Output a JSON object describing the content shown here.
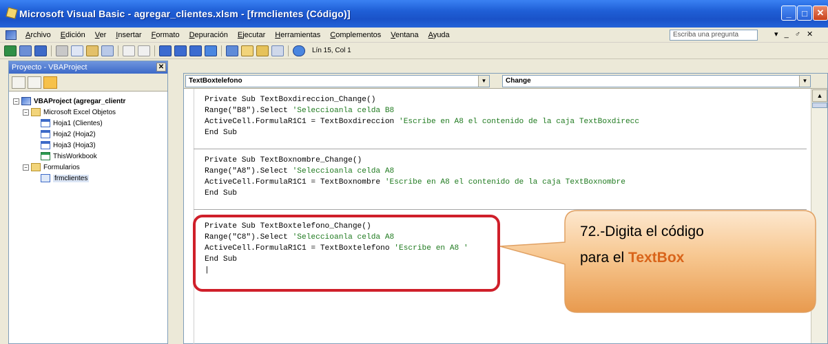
{
  "window": {
    "title": "Microsoft Visual Basic - agregar_clientes.xlsm - [frmclientes (Código)]",
    "controls": {
      "minimize": "_",
      "maximize": "□",
      "close": "✕"
    }
  },
  "menubar": {
    "items": [
      "Archivo",
      "Edición",
      "Ver",
      "Insertar",
      "Formato",
      "Depuración",
      "Ejecutar",
      "Herramientas",
      "Complementos",
      "Ventana",
      "Ayuda"
    ],
    "ask_placeholder": "Escriba una pregunta",
    "right_controls": "▾ _ ♂ ✕"
  },
  "toolbar": {
    "position_readout": "Lín 15, Col 1"
  },
  "project_pane": {
    "title": "Proyecto - VBAProject",
    "close": "✕",
    "tree": [
      {
        "label": "VBAProject (agregar_clientr",
        "toggle": "−",
        "depth": 0,
        "icon": "project-icon",
        "bold": true
      },
      {
        "label": "Microsoft Excel Objetos",
        "toggle": "−",
        "depth": 1,
        "icon": "folder-icon"
      },
      {
        "label": "Hoja1 (Clientes)",
        "depth": 2,
        "icon": "sheet-icon"
      },
      {
        "label": "Hoja2 (Hoja2)",
        "depth": 2,
        "icon": "sheet-icon"
      },
      {
        "label": "Hoja3 (Hoja3)",
        "depth": 2,
        "icon": "sheet-icon"
      },
      {
        "label": "ThisWorkbook",
        "depth": 2,
        "icon": "workbook-icon"
      },
      {
        "label": "Formularios",
        "toggle": "−",
        "depth": 1,
        "icon": "folder-icon"
      },
      {
        "label": "frmclientes",
        "depth": 2,
        "icon": "form-icon",
        "selected": true
      }
    ]
  },
  "code_window": {
    "object_combo": "TextBoxtelefono",
    "procedure_combo": "Change",
    "procedures": [
      {
        "lines": [
          {
            "code": "Private Sub TextBoxdireccion_Change()",
            "comment": ""
          },
          {
            "code": "Range(\"B8\").Select ",
            "comment": "'Seleccioanla celda B8"
          },
          {
            "code": "ActiveCell.FormulaR1C1 = TextBoxdireccion ",
            "comment": "'Escribe en A8 el contenido de la caja TextBoxdirecc"
          },
          {
            "code": "End Sub",
            "comment": ""
          }
        ]
      },
      {
        "lines": [
          {
            "code": "Private Sub TextBoxnombre_Change()",
            "comment": ""
          },
          {
            "code": "Range(\"A8\").Select ",
            "comment": "'Seleccioanla celda A8"
          },
          {
            "code": "ActiveCell.FormulaR1C1 = TextBoxnombre ",
            "comment": "'Escribe en A8 el contenido de la caja TextBoxnombre"
          },
          {
            "code": "End Sub",
            "comment": ""
          }
        ]
      },
      {
        "lines": [
          {
            "code": "Private Sub TextBoxtelefono_Change()",
            "comment": ""
          },
          {
            "code": "Range(\"C8\").Select ",
            "comment": "'Seleccioanla celda A8"
          },
          {
            "code": "ActiveCell.FormulaR1C1 = TextBoxtelefono ",
            "comment": "'Escribe en A8 '"
          },
          {
            "code": "End Sub",
            "comment": ""
          },
          {
            "code": "|",
            "comment": ""
          }
        ]
      }
    ]
  },
  "callout": {
    "line1": "72.-Digita el código",
    "line2_prefix": "para el ",
    "line2_highlight": "TextBox",
    "highlight_color": "#d9641a",
    "border_color": "#cf1f2a"
  }
}
